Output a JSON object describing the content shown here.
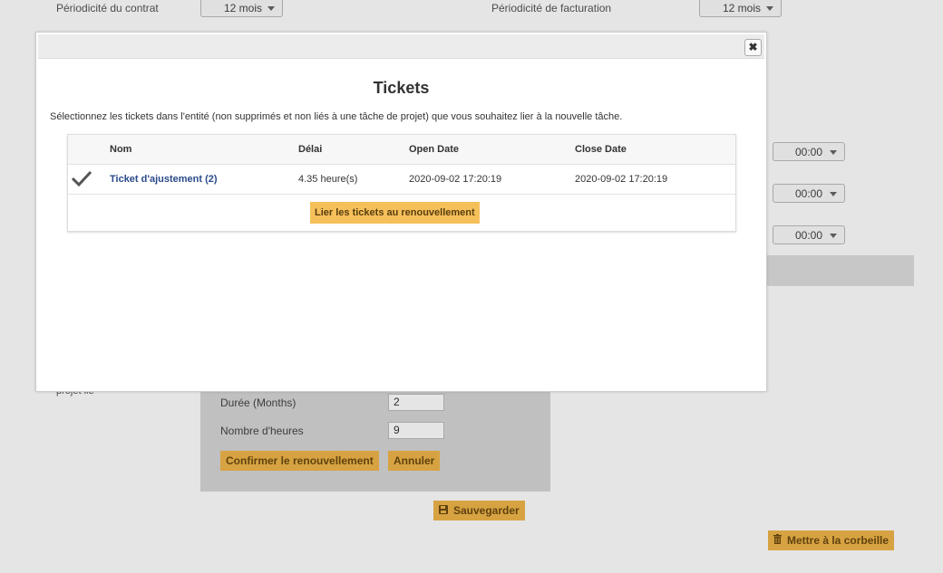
{
  "background": {
    "contract_period_label": "Périodicité du contrat",
    "contract_period_value": "12 mois",
    "billing_period_label": "Périodicité de facturation",
    "billing_period_value": "12 mois",
    "time_values": [
      "00:00",
      "00:00",
      "00:00"
    ],
    "project_label": "projet lié",
    "renewal": {
      "duration_label": "Durée (Months)",
      "duration_value": "2",
      "hours_label": "Nombre d'heures",
      "hours_value": "9",
      "confirm_label": "Confirmer le renouvellement",
      "cancel_label": "Annuler"
    },
    "save_label": "Sauvegarder",
    "trash_label": "Mettre à la corbeille"
  },
  "modal": {
    "title": "Tickets",
    "close_icon": "close-icon",
    "description": "Sélectionnez les tickets dans l'entité (non supprimés et non liés à une tâche de projet) que vous souhaitez lier à la nouvelle tâche.",
    "table": {
      "headers": {
        "name": "Nom",
        "delay": "Délai",
        "open_date": "Open Date",
        "close_date": "Close Date"
      },
      "rows": [
        {
          "selected": true,
          "name": "Ticket d'ajustement (2)",
          "delay": "4.35 heure(s)",
          "open_date": "2020-09-02 17:20:19",
          "close_date": "2020-09-02 17:20:19"
        }
      ]
    },
    "link_button_label": "Lier les tickets au renouvellement"
  }
}
